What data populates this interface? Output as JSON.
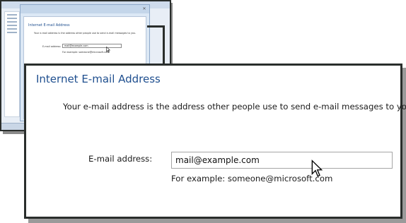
{
  "thumbnail": {
    "close_glyph": "✕",
    "heading": "Internet E-mail Address",
    "description": "Your e-mail address is the address other people use to send e-mail messages to you.",
    "email_label": "E-mail address:",
    "email_value": "mail@example.com",
    "example_text": "For example: someone@microsoft.com"
  },
  "dialog": {
    "heading": "Internet E-mail Address",
    "description": "Your e-mail address is the address other people use to send e-mail messages to you.",
    "email_label": "E-mail address:",
    "email_value": "mail@example.com",
    "example_text": "For example: someone@microsoft.com"
  },
  "colors": {
    "heading_blue": "#1f4f8f",
    "frame_dark": "#2a2e2c"
  },
  "icons": {
    "pointer": "mouse-pointer-icon"
  }
}
